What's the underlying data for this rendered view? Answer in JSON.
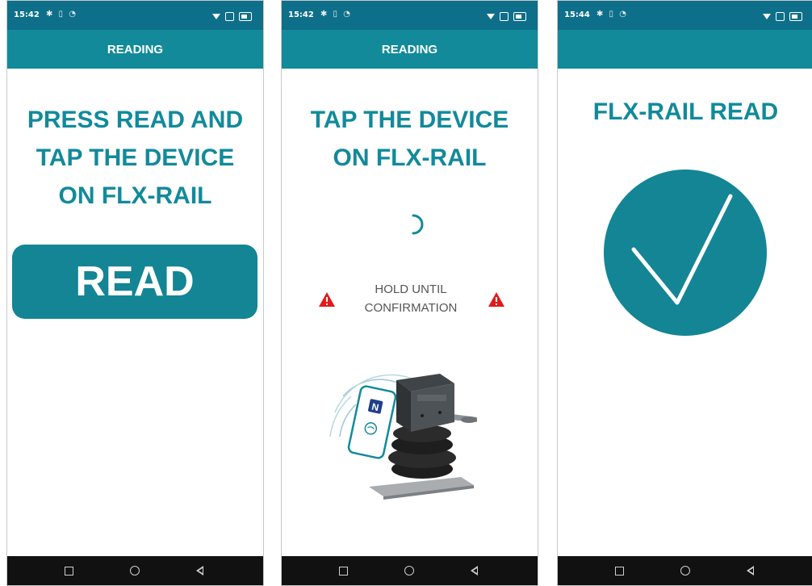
{
  "colors": {
    "accent": "#128a9a",
    "status_bar": "#0e6f8a",
    "warning": "#e01b1b",
    "nav_bar": "#111111"
  },
  "screens": [
    {
      "status": {
        "time": "15:42"
      },
      "appbar": {
        "title": "READING"
      },
      "headline": [
        "PRESS READ AND",
        "TAP THE DEVICE",
        "ON FLX-RAIL"
      ],
      "read_button": "READ"
    },
    {
      "status": {
        "time": "15:42"
      },
      "appbar": {
        "title": "READING"
      },
      "headline": [
        "TAP THE DEVICE",
        "ON FLX-RAIL"
      ],
      "hold_text": [
        "HOLD UNTIL",
        "CONFIRMATION"
      ],
      "icons": [
        "loading-spinner-icon",
        "warning-triangle-icon",
        "nfc-device-illustration"
      ]
    },
    {
      "status": {
        "time": "15:44"
      },
      "appbar": {
        "title": ""
      },
      "headline": [
        "FLX-RAIL READ"
      ],
      "icons": [
        "success-checkmark-icon"
      ]
    }
  ]
}
